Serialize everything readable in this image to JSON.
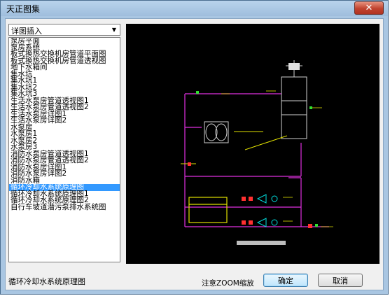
{
  "window": {
    "title": "天正图集",
    "close_icon": "close-icon"
  },
  "category_select": {
    "value": "详图插入"
  },
  "drawing_list": {
    "items": [
      "泵房平面",
      "泵房系统",
      "板式换热交换机房管道平面图",
      "板式换热交换机房管道透视图",
      "地下水箱间",
      "集水坑",
      "集水坑1",
      "集水坑2",
      "集水坑3",
      "生活水泵房管道透视图1",
      "生活水泵房管道透视图2",
      "生活水泵房详图1",
      "生活水泵房详图2",
      "水泵房",
      "水泵房1",
      "水泵房2",
      "水泵房3",
      "消防水泵房管道透视图1",
      "消防水泵房管道透视图2",
      "消防水泵房详图1",
      "消防水泵房详图2",
      "消防水箱",
      "循环冷却水系统原理图",
      "循环冷却水系统原理图1",
      "循环冷却水系统原理图2",
      "自行车坡道潜污泵排水系统图"
    ],
    "selected_index": 22
  },
  "preview": {
    "caption": "循环冷却水系统原理图"
  },
  "status": {
    "selected_name": "循环冷却水系统原理图",
    "zoom_hint": "注意ZOOM缩放"
  },
  "buttons": {
    "ok": "确定",
    "cancel": "取消"
  }
}
